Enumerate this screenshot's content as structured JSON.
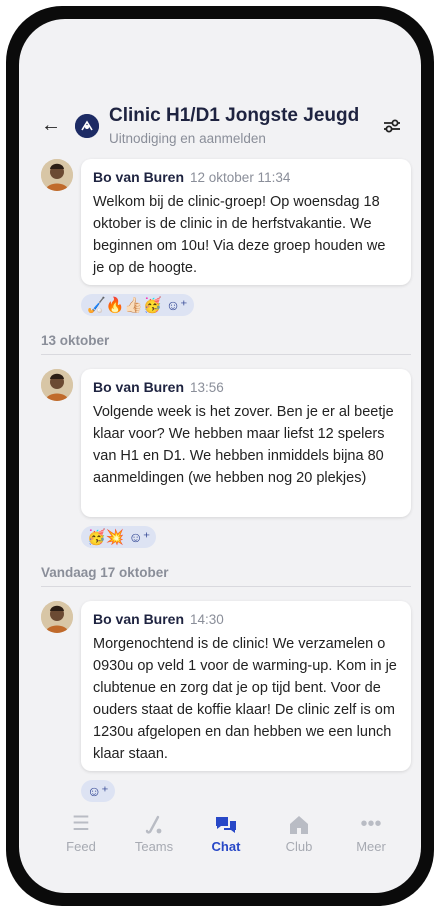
{
  "header": {
    "title": "Clinic H1/D1 Jongste Jeugd",
    "subtitle": "Uitnodiging en aanmelden"
  },
  "messages": [
    {
      "author": "Bo van Buren",
      "time": "12 oktober 11:34",
      "text": "Welkom bij de clinic-groep! Op woensdag 18 oktober is de clinic in de herfstvakantie. We beginnen om 10u! Via deze groep houden we je op de hoogte.",
      "reactions": "🏑🔥👍🏻🥳"
    },
    {
      "author": "Bo van Buren",
      "time": "13:56",
      "text": "Volgende week is het zover. Ben je er al beetje klaar voor? We hebben maar liefst 12 spelers van H1 en D1. We hebben inmiddels bijna 80 aanmeldingen (we hebben nog 20 plekjes)",
      "reactions": "🥳💥"
    },
    {
      "author": "Bo van Buren",
      "time": "14:30",
      "text": "Morgenochtend is de clinic! We verzamelen o 0930u op veld 1 voor de warming-up. Kom in je clubtenue en zorg dat je op tijd bent. Voor de ouders staat de koffie klaar! De clinic zelf is om 1230u afgelopen en dan hebben we een lunch klaar staan.",
      "reactions": ""
    }
  ],
  "date_separators": [
    "13 oktober",
    "Vandaag 17 oktober"
  ],
  "add_reaction_glyph": "☺⁺",
  "tabs": [
    {
      "label": "Feed",
      "icon": "menu-icon"
    },
    {
      "label": "Teams",
      "icon": "hockey-stick-icon"
    },
    {
      "label": "Chat",
      "icon": "chat-bubbles-icon"
    },
    {
      "label": "Club",
      "icon": "home-icon"
    },
    {
      "label": "Meer",
      "icon": "more-dots-icon"
    }
  ],
  "colors": {
    "accent": "#2848c7",
    "tab_inactive": "#b9bcc4",
    "screen_bg": "#f2f2f4"
  }
}
